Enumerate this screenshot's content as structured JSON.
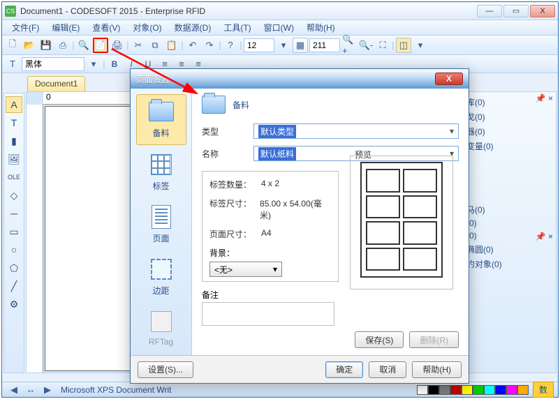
{
  "window": {
    "title": "Document1 - CODESOFT 2015 - Enterprise RFID",
    "minimize": "—",
    "maximize": "▭",
    "close": "X"
  },
  "menu": {
    "file": "文件(F)",
    "edit": "编辑(E)",
    "view": "查看(V)",
    "object": "对象(O)",
    "datasource": "数据源(D)",
    "tool": "工具(T)",
    "window": "窗口(W)",
    "help": "帮助(H)"
  },
  "toolbar": {
    "font_size_label": "12",
    "zoom_value": "211",
    "font_name": "黑体"
  },
  "doc_tab": "Document1",
  "ruler_zero": "0",
  "right_panel": {
    "items": [
      "库(0)",
      "戈(0)",
      "器(0)",
      "变量(0)"
    ],
    "items2": [
      "马(0)",
      "(0)",
      "(0)",
      "椭圆(0)",
      "约对象(0)"
    ],
    "badge": "数"
  },
  "status": {
    "printer": "Microsoft XPS Document Writ"
  },
  "dialog": {
    "title": "页面设置",
    "close": "X",
    "nav": {
      "stock": "备料",
      "label": "标签",
      "page": "页面",
      "margin": "边距",
      "rftag": "RFTag"
    },
    "header": "备料",
    "field_type": "类型",
    "type_value": "默认类型",
    "field_name": "名称",
    "name_value": "默认纸料",
    "info_count_label": "标签数量：",
    "info_count_value": "4 x 2",
    "info_labelsize_label": "标签尺寸：",
    "info_labelsize_value": "85.00 x 54.00(毫米)",
    "info_pagesize_label": "页面尺寸：",
    "info_pagesize_value": "A4",
    "bg_label": "背景：",
    "bg_value": "<无>",
    "preview_label": "预览",
    "remark_label": "备注",
    "save_btn": "保存(S)",
    "delete_btn": "删除(R)",
    "settings_btn": "设置(S)...",
    "ok_btn": "确定",
    "cancel_btn": "取消",
    "help_btn": "帮助(H)"
  }
}
